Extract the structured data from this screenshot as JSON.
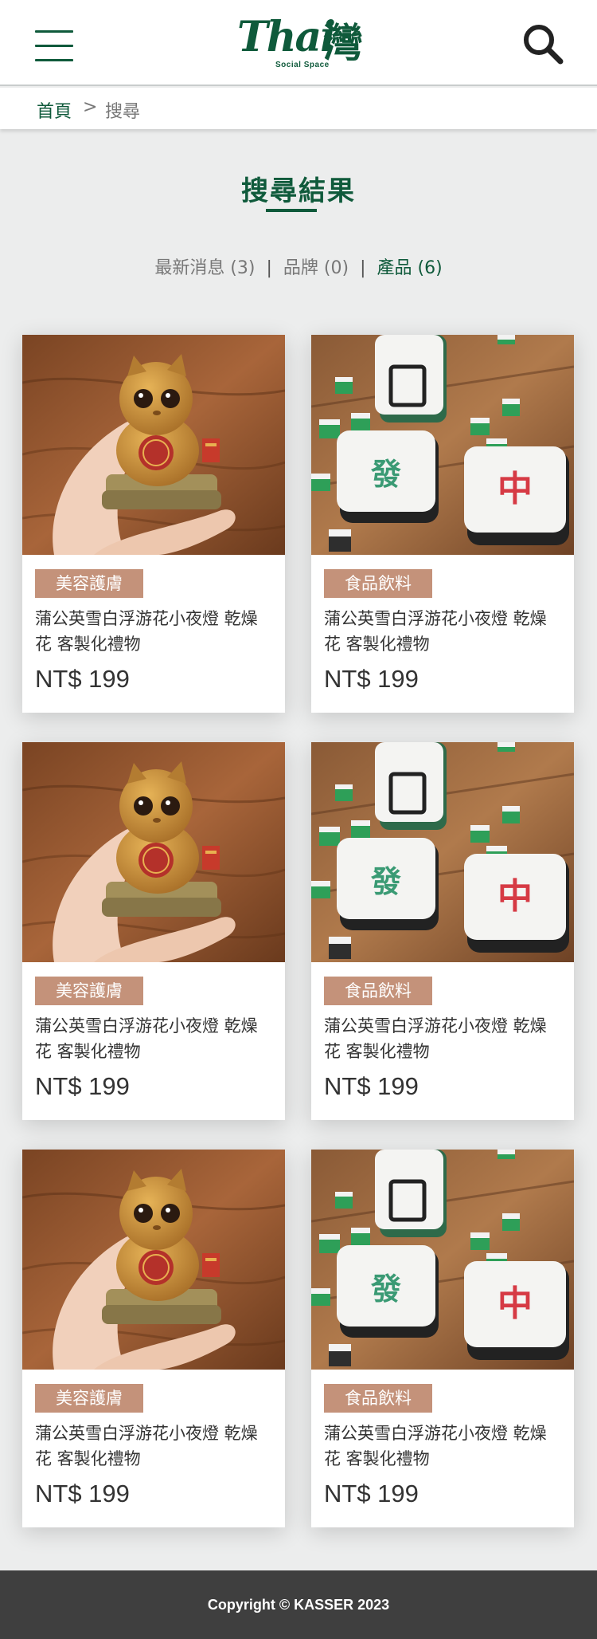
{
  "header": {
    "logo_text": "Thai",
    "logo_cjk": "灣",
    "logo_sub": "Social Space",
    "brand_color": "#0f5a3b",
    "menu_icon": "hamburger-icon",
    "search_icon": "search-icon"
  },
  "breadcrumb": {
    "home": "首頁",
    "separator": ">",
    "current": "搜尋"
  },
  "page": {
    "title": "搜尋結果"
  },
  "filters": [
    {
      "label": "最新消息 (3)",
      "active": false
    },
    {
      "label": "品牌 (0)",
      "active": false
    },
    {
      "label": "產品 (6)",
      "active": true
    }
  ],
  "filter_separator": "|",
  "products": [
    {
      "image": "cat-figurine",
      "tag": "美容護膚",
      "name": "蒲公英雪白浮游花小夜燈 乾燥花 客製化禮物",
      "price": "NT$ 199"
    },
    {
      "image": "mahjong-tiles",
      "tag": "食品飲料",
      "name": "蒲公英雪白浮游花小夜燈 乾燥花 客製化禮物",
      "price": "NT$ 199"
    },
    {
      "image": "cat-figurine",
      "tag": "美容護膚",
      "name": "蒲公英雪白浮游花小夜燈 乾燥花 客製化禮物",
      "price": "NT$ 199"
    },
    {
      "image": "mahjong-tiles",
      "tag": "食品飲料",
      "name": "蒲公英雪白浮游花小夜燈 乾燥花 客製化禮物",
      "price": "NT$ 199"
    },
    {
      "image": "cat-figurine",
      "tag": "美容護膚",
      "name": "蒲公英雪白浮游花小夜燈 乾燥花 客製化禮物",
      "price": "NT$ 199"
    },
    {
      "image": "mahjong-tiles",
      "tag": "食品飲料",
      "name": "蒲公英雪白浮游花小夜燈 乾燥花 客製化禮物",
      "price": "NT$ 199"
    }
  ],
  "colors": {
    "tag_bg": "#c4927a",
    "footer_bg": "#3f3f3f",
    "page_bg": "#eceded"
  },
  "footer": {
    "copyright": "Copyright © KASSER 2023"
  }
}
